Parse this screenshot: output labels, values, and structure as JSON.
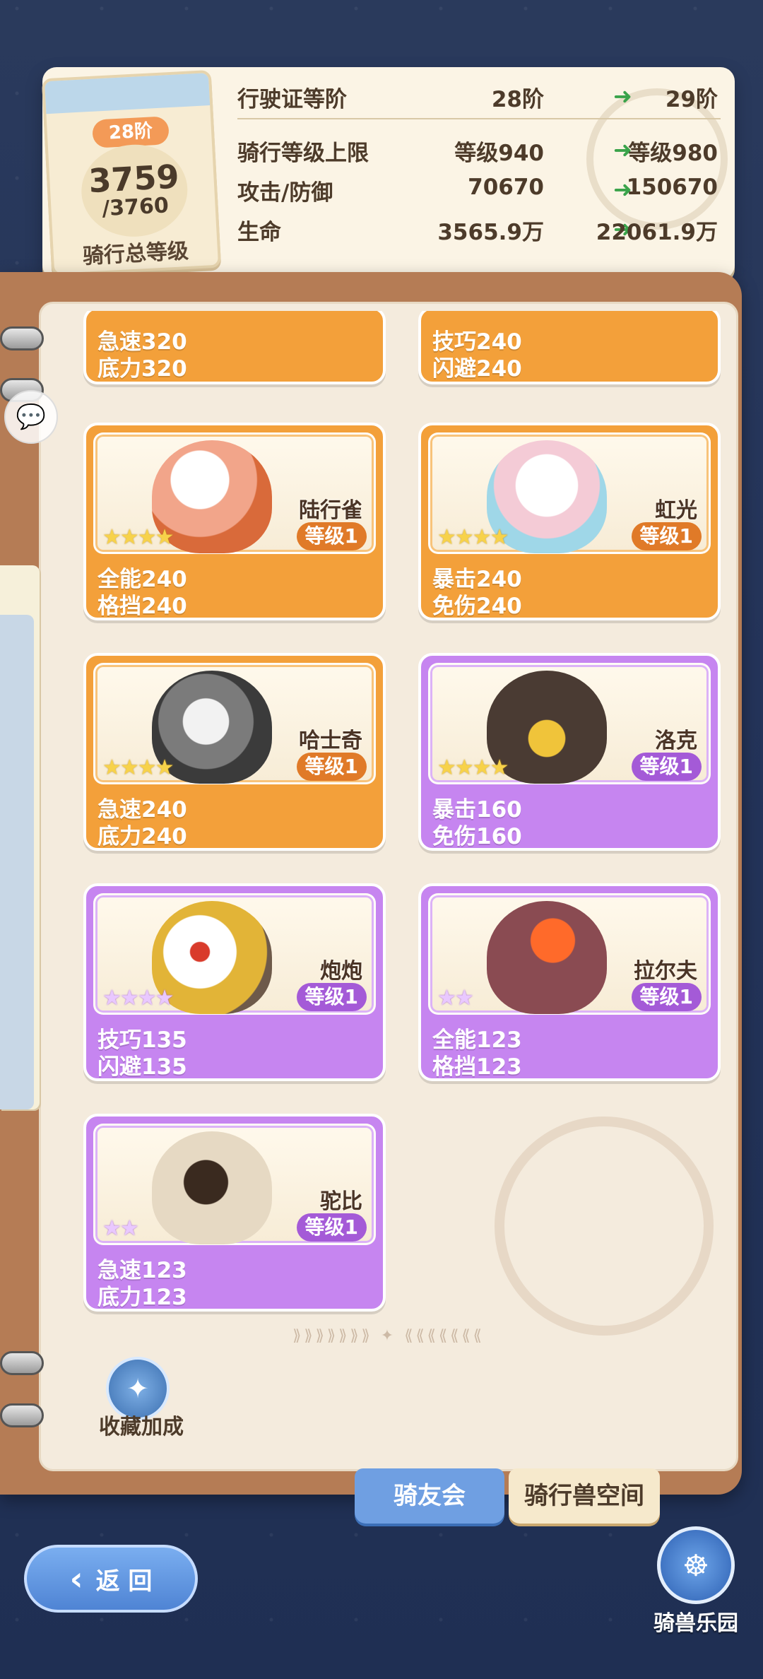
{
  "header": {
    "rank_pill": "28阶",
    "level_current": "3759",
    "level_max": "/3760",
    "level_label": "骑行总等级",
    "stats": [
      {
        "name": "行驶证等阶",
        "current": "28阶",
        "next": "29阶"
      },
      {
        "name": "骑行等级上限",
        "current": "等级940",
        "next": "等级980"
      },
      {
        "name": "攻击/防御",
        "current": "70670",
        "next": "150670"
      },
      {
        "name": "生命",
        "current": "3565.9万",
        "next": "22061.9万"
      }
    ]
  },
  "cards": [
    {
      "name": "",
      "level": "",
      "stars": "",
      "attr1": "急速320",
      "attr2": "底力320",
      "rarity": "orange"
    },
    {
      "name": "",
      "level": "",
      "stars": "",
      "attr1": "技巧240",
      "attr2": "闪避240",
      "rarity": "orange"
    },
    {
      "name": "陆行雀",
      "level": "等级1",
      "stars": "★★★★",
      "attr1": "全能240",
      "attr2": "格挡240",
      "rarity": "orange",
      "creature_color": "#d96a3a"
    },
    {
      "name": "虹光",
      "level": "等级1",
      "stars": "★★★★",
      "attr1": "暴击240",
      "attr2": "免伤240",
      "rarity": "orange",
      "creature_color": "#9fd7e8"
    },
    {
      "name": "哈士奇",
      "level": "等级1",
      "stars": "★★★★",
      "attr1": "急速240",
      "attr2": "底力240",
      "rarity": "orange",
      "creature_color": "#3b3b3b"
    },
    {
      "name": "洛克",
      "level": "等级1",
      "stars": "★★★★",
      "attr1": "暴击160",
      "attr2": "免伤160",
      "rarity": "purple",
      "creature_color": "#4a3b33"
    },
    {
      "name": "炮炮",
      "level": "等级1",
      "stars": "★★★★",
      "attr1": "技巧135",
      "attr2": "闪避135",
      "rarity": "purple",
      "creature_color": "#e2b437"
    },
    {
      "name": "拉尔夫",
      "level": "等级1",
      "stars": "★★",
      "attr1": "全能123",
      "attr2": "格挡123",
      "rarity": "purple",
      "creature_color": "#8a4b52"
    },
    {
      "name": "驼比",
      "level": "等级1",
      "stars": "★★",
      "attr1": "急速123",
      "attr2": "底力123",
      "rarity": "purple",
      "creature_color": "#e6d9c3"
    }
  ],
  "collect_bonus": {
    "label": "收藏加成",
    "icon": "paw-star-icon"
  },
  "tabs": {
    "active": "骑友会",
    "inactive": "骑行兽空间"
  },
  "back_button": {
    "label": "返 回",
    "icon": "back-arrow-icon"
  },
  "park_button": {
    "label": "骑兽乐园",
    "icon": "ferris-wheel-icon"
  },
  "colors": {
    "orange": "#f3a03a",
    "purple": "#c685f0",
    "blue": "#6f9fe2"
  }
}
